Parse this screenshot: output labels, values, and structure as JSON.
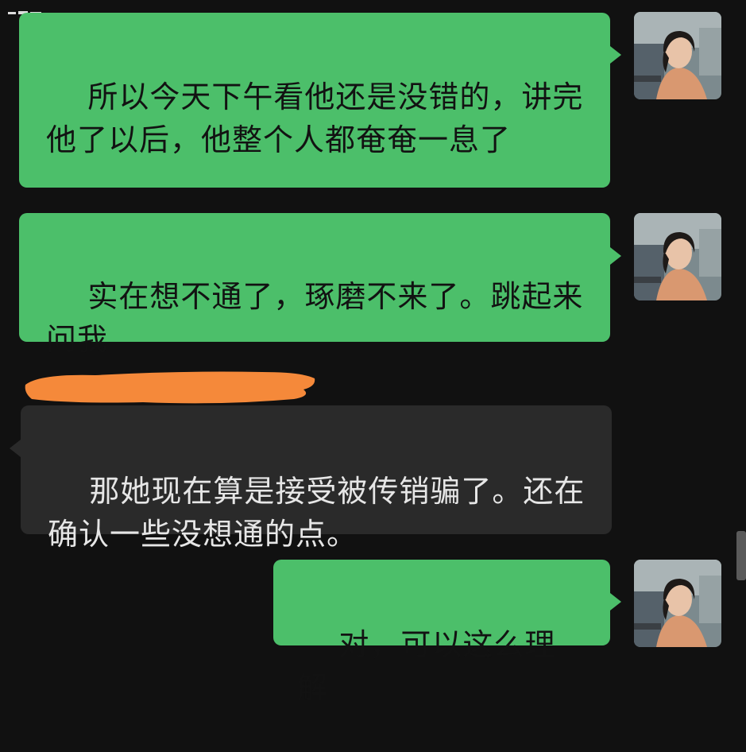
{
  "messages": [
    {
      "direction": "sent",
      "text": "所以今天下午看他还是没错的，讲完他了以后，他整个人都奄奄一息了"
    },
    {
      "direction": "sent",
      "text": "实在想不通了，琢磨不来了。跳起来问我"
    },
    {
      "direction": "received",
      "text": "那她现在算是接受被传销骗了。还在确认一些没想通的点。"
    },
    {
      "direction": "sent",
      "text": "对，可以这么理解"
    }
  ],
  "colors": {
    "background": "#111111",
    "sent_bubble": "#4cbf6a",
    "received_bubble": "#2a2a2a",
    "redaction": "#f5893a"
  },
  "icons": {
    "avatar": "user-avatar-photo",
    "redaction": "redacted-sender-name"
  }
}
